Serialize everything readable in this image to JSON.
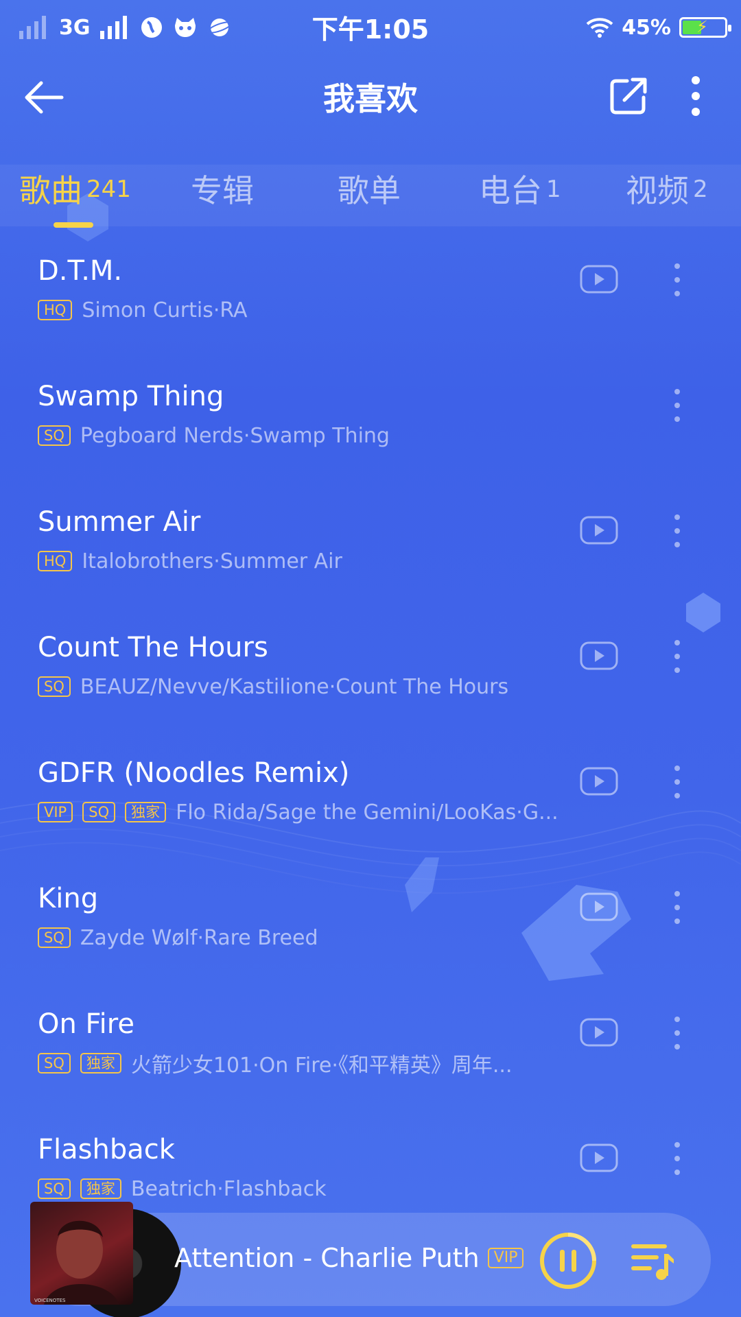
{
  "status_bar": {
    "network": "3G",
    "time": "下午1:05",
    "battery": "45%",
    "battery_level": 0.45
  },
  "header": {
    "title": "我喜欢"
  },
  "tabs": [
    {
      "label": "歌曲",
      "count": "241",
      "active": true
    },
    {
      "label": "专辑",
      "count": ""
    },
    {
      "label": "歌单",
      "count": ""
    },
    {
      "label": "电台",
      "count": "1"
    },
    {
      "label": "视频",
      "count": "2"
    }
  ],
  "songs": [
    {
      "title": "D.T.M.",
      "badges": [
        "HQ"
      ],
      "artist": "Simon Curtis·RA",
      "has_mv": true
    },
    {
      "title": "Swamp Thing",
      "badges": [
        "SQ"
      ],
      "artist": "Pegboard Nerds·Swamp Thing",
      "has_mv": false
    },
    {
      "title": "Summer Air",
      "badges": [
        "HQ"
      ],
      "artist": "Italobrothers·Summer Air",
      "has_mv": true
    },
    {
      "title": "Count The Hours",
      "badges": [
        "SQ"
      ],
      "artist": "BEAUZ/Nevve/Kastilione·Count The Hours",
      "has_mv": true
    },
    {
      "title": "GDFR (Noodles Remix)",
      "badges": [
        "VIP",
        "SQ",
        "独家"
      ],
      "artist": "Flo Rida/Sage the Gemini/LooKas·G...",
      "has_mv": true
    },
    {
      "title": "King",
      "badges": [
        "SQ"
      ],
      "artist": "Zayde Wølf·Rare Breed",
      "has_mv": true
    },
    {
      "title": "On Fire",
      "badges": [
        "SQ",
        "独家"
      ],
      "artist": "火箭少女101·On Fire·《和平精英》周年...",
      "has_mv": true
    },
    {
      "title": "Flashback",
      "badges": [
        "SQ",
        "独家"
      ],
      "artist": "Beatrich·Flashback",
      "has_mv": true
    }
  ],
  "player": {
    "now_playing": "Attention - Charlie Puth",
    "badge": "VIP",
    "cover_text": "VOICENOTES"
  },
  "icons": {
    "back": "arrow-left-icon",
    "share": "share-icon",
    "more": "more-vertical-icon",
    "mv": "mv-play-icon",
    "pause": "pause-icon",
    "playlist": "playlist-icon"
  },
  "colors": {
    "accent": "#f6d349",
    "background": "#4167ea",
    "badge": "#f6c548"
  }
}
